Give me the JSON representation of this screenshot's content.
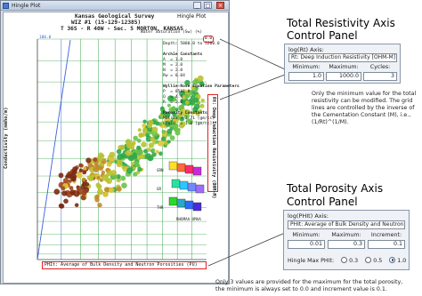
{
  "window": {
    "title": "Hingle Plot",
    "controls": {
      "minimize": "_",
      "maximize": "□",
      "close": "×"
    }
  },
  "plot_header": {
    "line1": "Kansas Geological Survey",
    "line2": "WIZ #1 (15-129-12385)",
    "line3": "T 36S - R 40W - Sec. 5 MORTON, KANSAS",
    "hingle_label": "Hingle Plot"
  },
  "axes": {
    "y_label": "Conductivity (mmho/m)",
    "x_label": "PHIt: Average of Bulk Density and Neutron Porosities (PU)",
    "rt_label": "Rt: Deep Induction Resistivity (OHM-M)",
    "top_left_value": "100.0",
    "top_right_value": "0.0",
    "water_saturation": "Water Saturation (Sw) (%)"
  },
  "parameters": {
    "depth": "Depth: 5080.0 to 5200.0",
    "archie_title": "Archie Constants",
    "archie": [
      "A  = 1.0",
      "M  = 2.0",
      "N  = 2.0",
      "Rw = 0.04"
    ],
    "vsh_title": "Wyllie-Rose Equation Parameters",
    "vsh": [
      "P  = 8581.0",
      "Q  = 4.4",
      "R  = 2.0"
    ],
    "porosity_title": "Porosity Constants",
    "porosity": [
      "Matrix = 2.71 [gm/cc]",
      "Fluid  = 1.0 [gm/cc]"
    ]
  },
  "legend_cube": {
    "labels": [
      "GRN",
      "GR",
      "THR"
    ],
    "bottom_label": "RHOMAA-UMAA"
  },
  "resistivity_panel": {
    "heading_line1": "Total Resistivity Axis",
    "heading_line2": "Control Panel",
    "title": "log(Rt) Axis:",
    "field": "Rt: Deep Induction Resistivity [OHM-M]",
    "labels": [
      "Minimum:",
      "Maximum:",
      "Cycles:"
    ],
    "values": [
      "1.0",
      "1000.0",
      "3"
    ],
    "note": "Only the minimum  value for the total resistivity can be modified.  The grid lines are controlled by the inverse of the Cementation Constant (M), i.e., (1/Rt)^(1/M)."
  },
  "porosity_panel": {
    "heading_line1": "Total Porosity Axis",
    "heading_line2": "Control Panel",
    "title": "log(PHIt) Axis:",
    "field": "PHIt: Average of Bulk Density and Neutron Por",
    "labels": [
      "Minimum:",
      "Maximum:",
      "Increment:"
    ],
    "values": [
      "0.01",
      "0.3",
      "0.1"
    ],
    "max_label": "Hingle Max PHIt:",
    "radio_options": [
      "0.3",
      "0.5",
      "1.0"
    ],
    "radio_selected": "1.0"
  },
  "footer": {
    "line1": "Only 3 values are provided  for the maximum  for the total porosity,",
    "line2": "the minimum is always set to 0.0 and increment value is 0.1."
  },
  "colors": {
    "red_highlight": "#dd2222",
    "panel_bg": "#eef1f5",
    "grid_green": "#3aa84a",
    "sat_line_blue": "#3a63d8"
  }
}
